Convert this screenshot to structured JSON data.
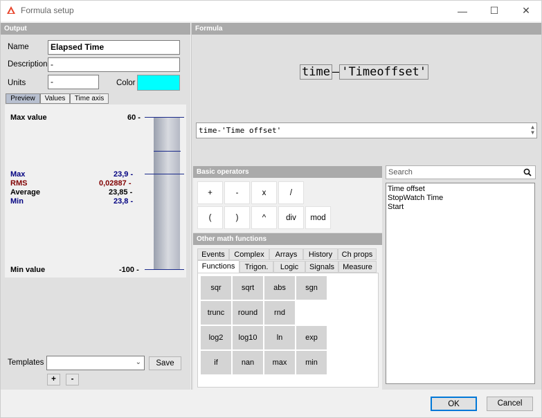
{
  "window": {
    "title": "Formula setup",
    "icons": {
      "logo": "dewesoft-logo-icon",
      "minimize": "minimize-icon",
      "maximize": "maximize-icon",
      "close": "close-icon"
    },
    "minimize_glyph": "—",
    "maximize_glyph": "☐",
    "close_glyph": "✕"
  },
  "output": {
    "header": "Output",
    "name_label": "Name",
    "name_value": "Elapsed Time",
    "description_label": "Description",
    "description_value": "-",
    "units_label": "Units",
    "units_value": "-",
    "color_label": "Color",
    "color_value": "#00ffff",
    "view_tabs": [
      "Preview",
      "Values",
      "Time axis"
    ],
    "active_view_tab": "Preview",
    "preview": {
      "max_value_label": "Max value",
      "max_value": "60 -",
      "stats": [
        {
          "label": "Max",
          "value": "23,9 -",
          "color": "#000080"
        },
        {
          "label": "RMS",
          "value": "0,02887 -",
          "color": "#800000"
        },
        {
          "label": "Average",
          "value": "23,85 -",
          "color": "#000000"
        },
        {
          "label": "Min",
          "value": "23,8 -",
          "color": "#000080"
        }
      ],
      "min_value_label": "Min value",
      "min_value": "-100 -"
    },
    "templates_label": "Templates",
    "templates_value": "",
    "save_label": "Save",
    "plus_label": "+",
    "minus_label": "-"
  },
  "formula": {
    "header": "Formula",
    "rendered": {
      "token1": "time",
      "op": "–",
      "token2": "'Timeoffset'"
    },
    "text": "time-'Time offset'",
    "basic_operators_header": "Basic operators",
    "operators_row1": [
      "+",
      "-",
      "x",
      "/"
    ],
    "operators_row2": [
      "(",
      ")",
      "^",
      "div",
      "mod"
    ],
    "other_math_header": "Other math functions",
    "tabs_row1": [
      "Events",
      "Complex",
      "Arrays",
      "History",
      "Ch props"
    ],
    "tabs_row2": [
      "Functions",
      "Trigon.",
      "Logic",
      "Signals",
      "Measure"
    ],
    "active_tab": "Functions",
    "functions": [
      [
        "sqr",
        "sqrt",
        "abs",
        "sgn"
      ],
      [
        "trunc",
        "round",
        "rnd"
      ],
      [
        "log2",
        "log10",
        "ln",
        "exp"
      ],
      [
        "if",
        "nan",
        "max",
        "min"
      ]
    ],
    "search_placeholder": "Search",
    "channels": [
      "Time offset",
      "StopWatch Time",
      "Start"
    ]
  },
  "footer": {
    "ok_label": "OK",
    "cancel_label": "Cancel"
  }
}
